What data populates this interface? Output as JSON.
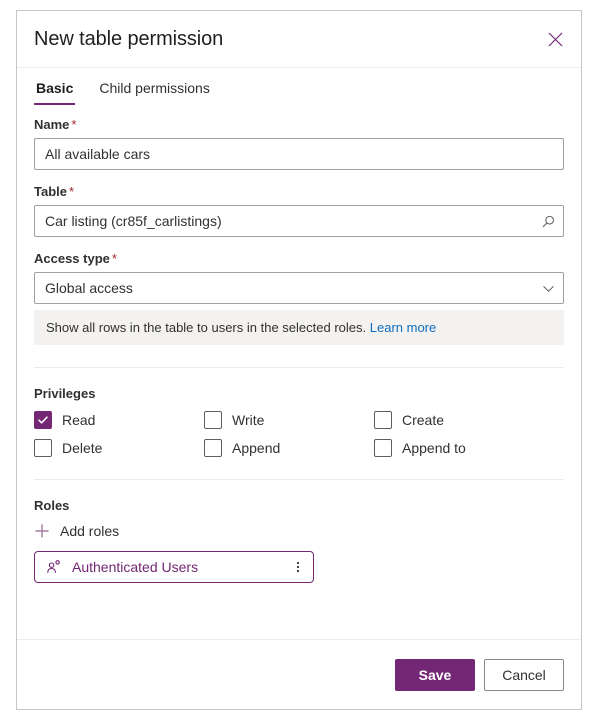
{
  "dialog": {
    "title": "New table permission",
    "close_icon": "close-icon"
  },
  "tabs": [
    {
      "label": "Basic",
      "active": true
    },
    {
      "label": "Child permissions",
      "active": false
    }
  ],
  "form": {
    "name": {
      "label": "Name",
      "required_marker": "*",
      "value": "All available cars",
      "placeholder": ""
    },
    "table": {
      "label": "Table",
      "required_marker": "*",
      "value": "Car listing (cr85f_carlistings)",
      "placeholder": "",
      "icon": "search-icon"
    },
    "access_type": {
      "label": "Access type",
      "required_marker": "*",
      "value": "Global access",
      "icon": "chevron-down-icon",
      "options": [
        "Global access"
      ]
    },
    "info": {
      "text": "Show all rows in the table to users in the selected roles.",
      "link_text": "Learn more",
      "link_color": "#0f6cbd",
      "background": "#f3f2f1"
    }
  },
  "privileges": {
    "title": "Privileges",
    "items": [
      {
        "label": "Read",
        "checked": true
      },
      {
        "label": "Write",
        "checked": false
      },
      {
        "label": "Create",
        "checked": false
      },
      {
        "label": "Delete",
        "checked": false
      },
      {
        "label": "Append",
        "checked": false
      },
      {
        "label": "Append to",
        "checked": false
      }
    ]
  },
  "roles": {
    "title": "Roles",
    "add_label": "Add roles",
    "add_icon": "plus-icon",
    "items": [
      {
        "label": "Authenticated Users",
        "icon": "person-icon",
        "menu_icon": "more-vertical-icon"
      }
    ]
  },
  "footer": {
    "save_label": "Save",
    "cancel_label": "Cancel"
  },
  "colors": {
    "accent": "#742774",
    "link": "#0f6cbd",
    "required": "#a4262c",
    "info_bg": "#f3f2f1",
    "border": "#c8c6c4"
  }
}
